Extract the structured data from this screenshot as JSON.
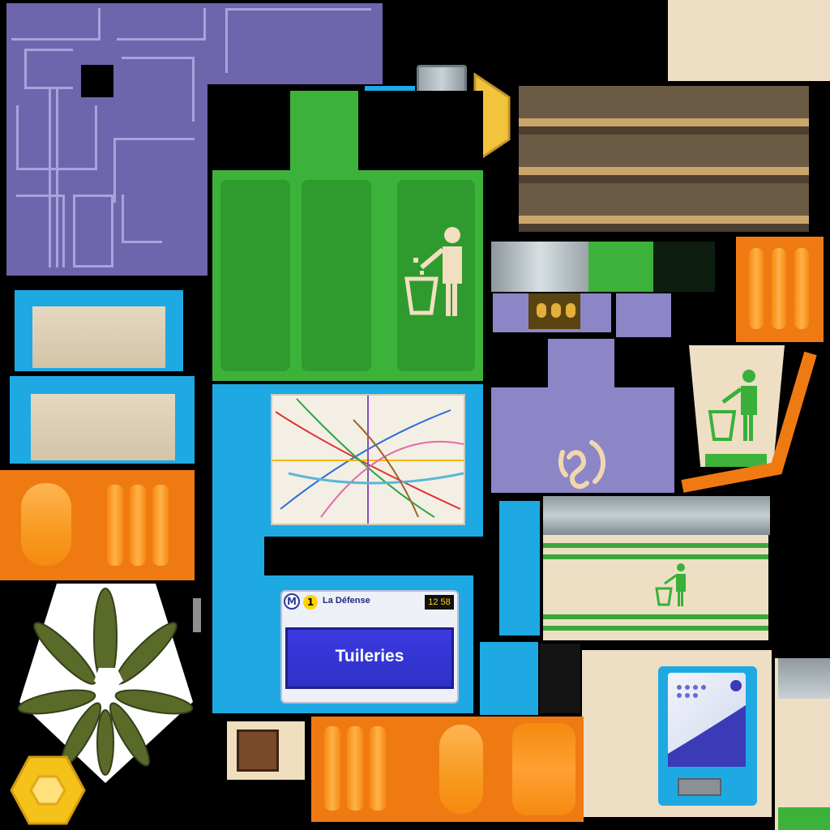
{
  "sign": {
    "metro_letter": "M",
    "line_number": "1",
    "destination": "La Défense",
    "time": "12 58",
    "station": "Tuileries"
  },
  "icons": [
    "trash-bin-person-icon",
    "ear-icon",
    "metro-map",
    "ticket-machine",
    "plant-top-view",
    "hexagon-bolt"
  ],
  "colors": {
    "purple": "#6e66ad",
    "green": "#3db23a",
    "cyan": "#1fa9e3",
    "orange": "#f07a12",
    "cream": "#eedfc4",
    "metro_yellow": "#ffd200",
    "sign_blue": "#3434d6"
  }
}
